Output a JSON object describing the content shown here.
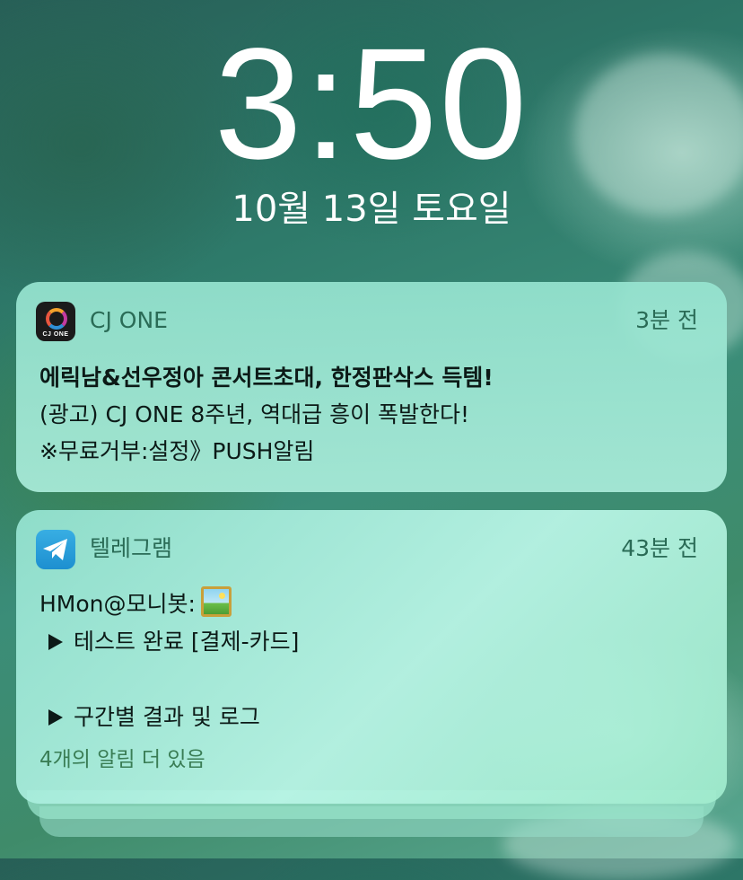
{
  "lockscreen": {
    "time": "3:50",
    "date": "10월 13일 토요일"
  },
  "notifications": [
    {
      "app_name": "CJ ONE",
      "app_icon": "cj-one-icon",
      "icon_text": "CJ ONE",
      "time_ago": "3분 전",
      "title": "에릭남&선우정아 콘서트초대, 한정판삭스 득템!",
      "lines": [
        "(광고) CJ ONE 8주년, 역대급 흥이 폭발한다!",
        "※무료거부:설정》PUSH알림"
      ]
    },
    {
      "app_name": "텔레그램",
      "app_icon": "telegram-icon",
      "time_ago": "43분 전",
      "sender_line": "HMon@모니봇:",
      "lines": [
        "테스트 완료 [결제-카드]",
        "구간별 결과 및 로그"
      ],
      "more_text": "4개의 알림 더 있음"
    }
  ],
  "colors": {
    "card_bg": "#aaebd7",
    "meta_text": "#2a6b56",
    "more_text": "#3a7d55",
    "telegram_blue": "#2a9fdc"
  }
}
